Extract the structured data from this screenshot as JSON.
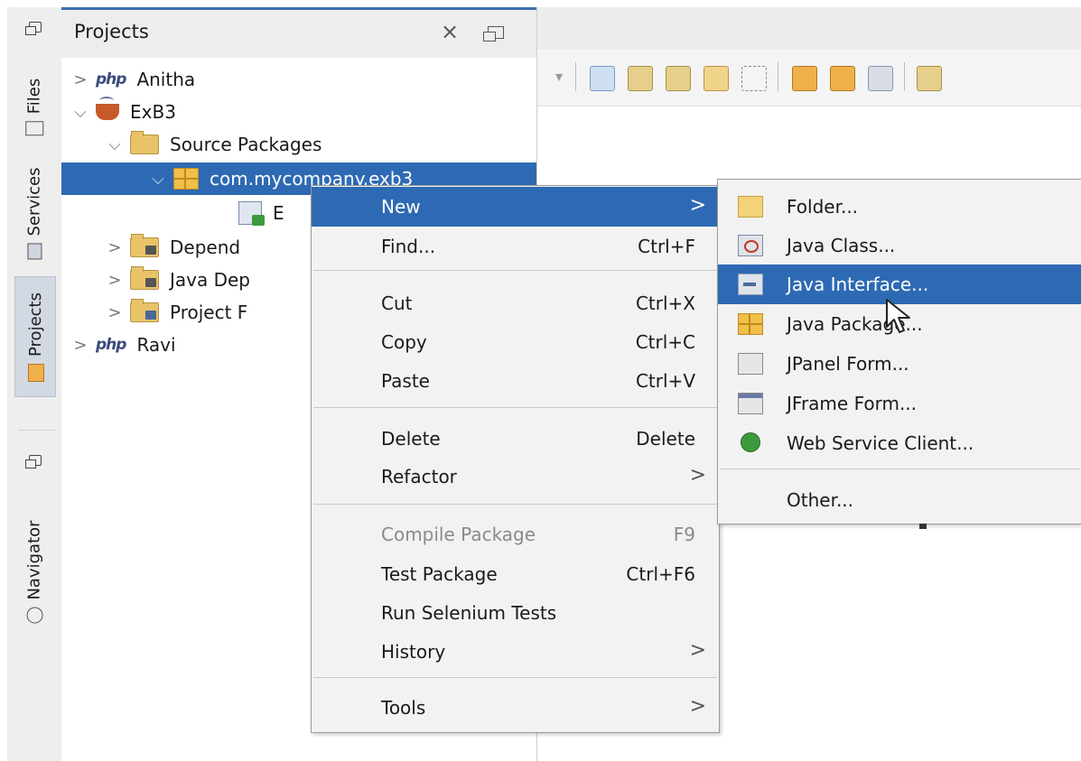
{
  "sidebar": {
    "tabs": [
      {
        "label": "Files"
      },
      {
        "label": "Services"
      },
      {
        "label": "Projects"
      },
      {
        "label": "Navigator"
      }
    ]
  },
  "projects_panel": {
    "title": "Projects",
    "close_glyph": "×",
    "tree": [
      {
        "label": "Anitha",
        "icon": "php-icon"
      },
      {
        "label": "ExB3",
        "icon": "java-project-icon"
      },
      {
        "label": "Source Packages",
        "icon": "source-folder-icon"
      },
      {
        "label": "com.mycompany.exb3",
        "icon": "package-icon"
      },
      {
        "label": "E",
        "icon": "java-file-icon"
      },
      {
        "label": "Depend",
        "icon": "dependencies-icon"
      },
      {
        "label": "Java Dep",
        "icon": "java-dependencies-icon"
      },
      {
        "label": "Project F",
        "icon": "project-files-icon"
      },
      {
        "label": "Ravi",
        "icon": "php-icon"
      }
    ]
  },
  "context_menu": {
    "items": [
      {
        "label": "New",
        "shortcut": "",
        "submenu": true
      },
      {
        "label": "Find...",
        "shortcut": "Ctrl+F"
      },
      {
        "label": "Cut",
        "shortcut": "Ctrl+X"
      },
      {
        "label": "Copy",
        "shortcut": "Ctrl+C"
      },
      {
        "label": "Paste",
        "shortcut": "Ctrl+V"
      },
      {
        "label": "Delete",
        "shortcut": "Delete"
      },
      {
        "label": "Refactor",
        "shortcut": "",
        "submenu": true
      },
      {
        "label": "Compile Package",
        "shortcut": "F9",
        "disabled": true
      },
      {
        "label": "Test Package",
        "shortcut": "Ctrl+F6"
      },
      {
        "label": "Run Selenium Tests",
        "shortcut": ""
      },
      {
        "label": "History",
        "shortcut": "",
        "submenu": true
      },
      {
        "label": "Tools",
        "shortcut": "",
        "submenu": true
      }
    ],
    "submenu_arrow": ">"
  },
  "new_submenu": {
    "items": [
      {
        "label": "Folder...",
        "icon": "folder-icon"
      },
      {
        "label": "Java Class...",
        "icon": "java-class-icon"
      },
      {
        "label": "Java Interface...",
        "icon": "java-interface-icon",
        "highlighted": true
      },
      {
        "label": "Java Package...",
        "icon": "java-package-icon"
      },
      {
        "label": "JPanel Form...",
        "icon": "jpanel-form-icon"
      },
      {
        "label": "JFrame Form...",
        "icon": "jframe-form-icon"
      },
      {
        "label": "Web Service Client...",
        "icon": "web-service-client-icon"
      },
      {
        "label": "Other...",
        "icon": ""
      }
    ]
  },
  "colors": {
    "selection": "#2e6ab3",
    "menu_bg": "#f2f2f2",
    "panel_accent": "#3c6fa8"
  }
}
